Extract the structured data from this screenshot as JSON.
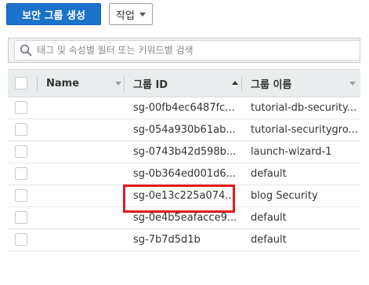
{
  "toolbar": {
    "create_label": "보안 그룹 생성",
    "actions_label": "작업"
  },
  "filter": {
    "placeholder": "태그 및 속성별 필터 또는 키워드별 검색"
  },
  "table": {
    "columns": {
      "name": "Name",
      "group_id": "그룹 ID",
      "group_name": "그룹 이름"
    },
    "rows": [
      {
        "name": "",
        "group_id": "sg-00fb4ec6487fc...",
        "group_name": "tutorial-db-security..."
      },
      {
        "name": "",
        "group_id": "sg-054a930b61ab...",
        "group_name": "tutorial-securitygro..."
      },
      {
        "name": "",
        "group_id": "sg-0743b42d598b...",
        "group_name": "launch-wizard-1"
      },
      {
        "name": "",
        "group_id": "sg-0b364ed001d6...",
        "group_name": "default"
      },
      {
        "name": "",
        "group_id": "sg-0e13c225a074...",
        "group_name": "blog Security"
      },
      {
        "name": "",
        "group_id": "sg-0e4b5eafacce9...",
        "group_name": "default"
      },
      {
        "name": "",
        "group_id": "sg-7b7d5d1b",
        "group_name": "default"
      }
    ]
  },
  "colors": {
    "primary_button": "#1a73c9",
    "highlight_box": "#e01b1b"
  },
  "icons": {
    "search": "search-icon",
    "actions_dropdown": "chevron-down-icon"
  }
}
